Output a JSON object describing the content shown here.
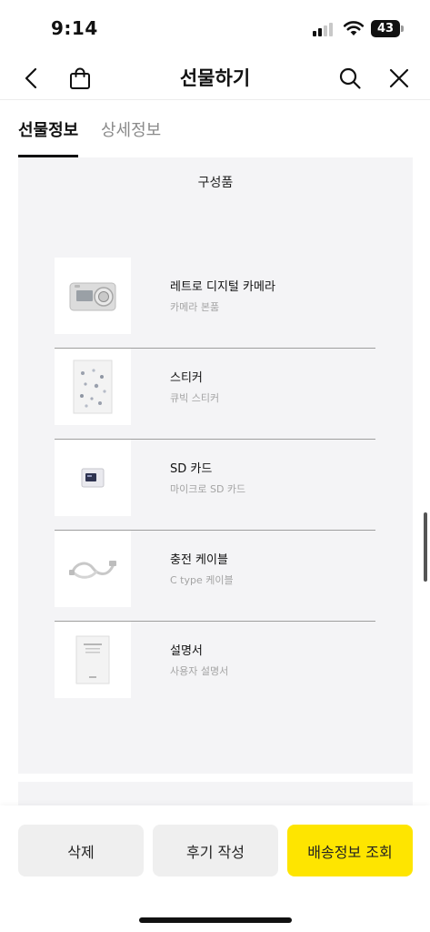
{
  "status_bar": {
    "time": "9:14",
    "battery_level": "43"
  },
  "nav": {
    "title": "선물하기",
    "back_icon": "chevron-left-icon",
    "bag_icon": "shopping-bag-icon",
    "search_icon": "search-icon",
    "close_icon": "close-icon"
  },
  "tabs": [
    {
      "label": "선물정보",
      "active": true
    },
    {
      "label": "상세정보",
      "active": false
    }
  ],
  "components": {
    "title": "구성품",
    "items": [
      {
        "name": "레트로 디지털 카메라",
        "sub": "카메라 본품",
        "thumb_icon": "camera-icon"
      },
      {
        "name": "스티커",
        "sub": "큐빅 스티커",
        "thumb_icon": "sticker-sheet-icon"
      },
      {
        "name": "SD 카드",
        "sub": "마이크로 SD 카드",
        "thumb_icon": "sd-card-icon"
      },
      {
        "name": "충전 케이블",
        "sub": "C type 케이블",
        "thumb_icon": "cable-icon"
      },
      {
        "name": "설명서",
        "sub": "사용자 설명서",
        "thumb_icon": "manual-icon"
      }
    ]
  },
  "actions": {
    "delete_label": "삭제",
    "review_label": "후기 작성",
    "shipping_label": "배송정보 조회",
    "accent_color": "#fee500"
  }
}
